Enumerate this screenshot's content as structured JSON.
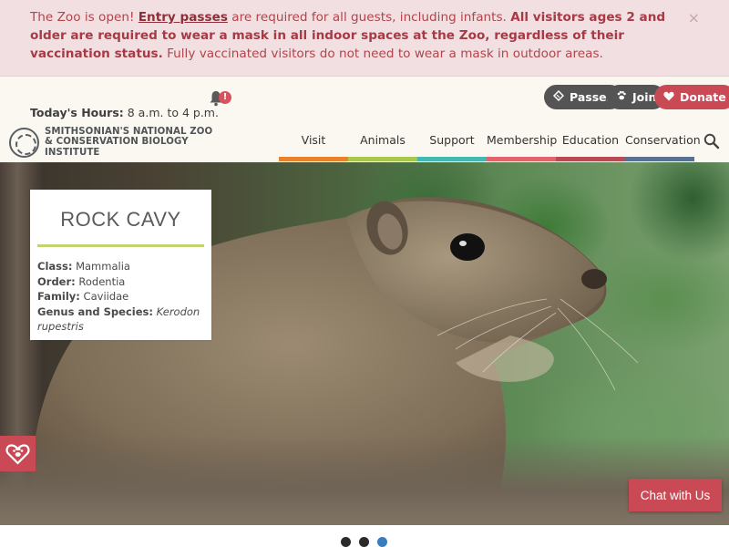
{
  "alert": {
    "intro": "The Zoo is open! ",
    "link": "Entry passes",
    "mid": " are required for all guests, including infants. ",
    "bold": "All visitors ages 2 and older are required to wear a mask in all indoor spaces at the Zoo, regardless of their vaccination status.",
    "tail": " Fully vaccinated visitors do not need to wear a mask in outdoor areas.",
    "close": "×"
  },
  "header": {
    "hours_label": "Today's Hours:",
    "hours_value": " 8 a.m. to 4 p.m.",
    "notification_badge": "!",
    "logo_line1": "SMITHSONIAN'S NATIONAL ZOO",
    "logo_line2": "& CONSERVATION BIOLOGY INSTITUTE",
    "buttons": {
      "passes": "Passes",
      "join": "Join",
      "donate": "Donate"
    },
    "nav": [
      {
        "label": "Visit",
        "color": "#e8812a"
      },
      {
        "label": "Animals",
        "color": "#a9c74a"
      },
      {
        "label": "Support",
        "color": "#42b8b0"
      },
      {
        "label": "Membership",
        "color": "#e0646b"
      },
      {
        "label": "Education",
        "color": "#b64b56"
      },
      {
        "label": "Conservation",
        "color": "#5a7090"
      }
    ]
  },
  "hero": {
    "title": "ROCK CAVY",
    "class_label": "Class:",
    "class_value": " Mammalia",
    "order_label": "Order:",
    "order_value": " Rodentia",
    "family_label": "Family:",
    "family_value": " Caviidae",
    "species_label": "Genus and Species:",
    "species_value": "Kerodon rupestris"
  },
  "chat": {
    "label": "Chat with Us"
  },
  "carousel": {
    "slides": 3,
    "active": 3
  },
  "colors": {
    "accent": "#c94a55",
    "dark_pill": "#545454",
    "alert_bg": "#f1dfe1"
  }
}
